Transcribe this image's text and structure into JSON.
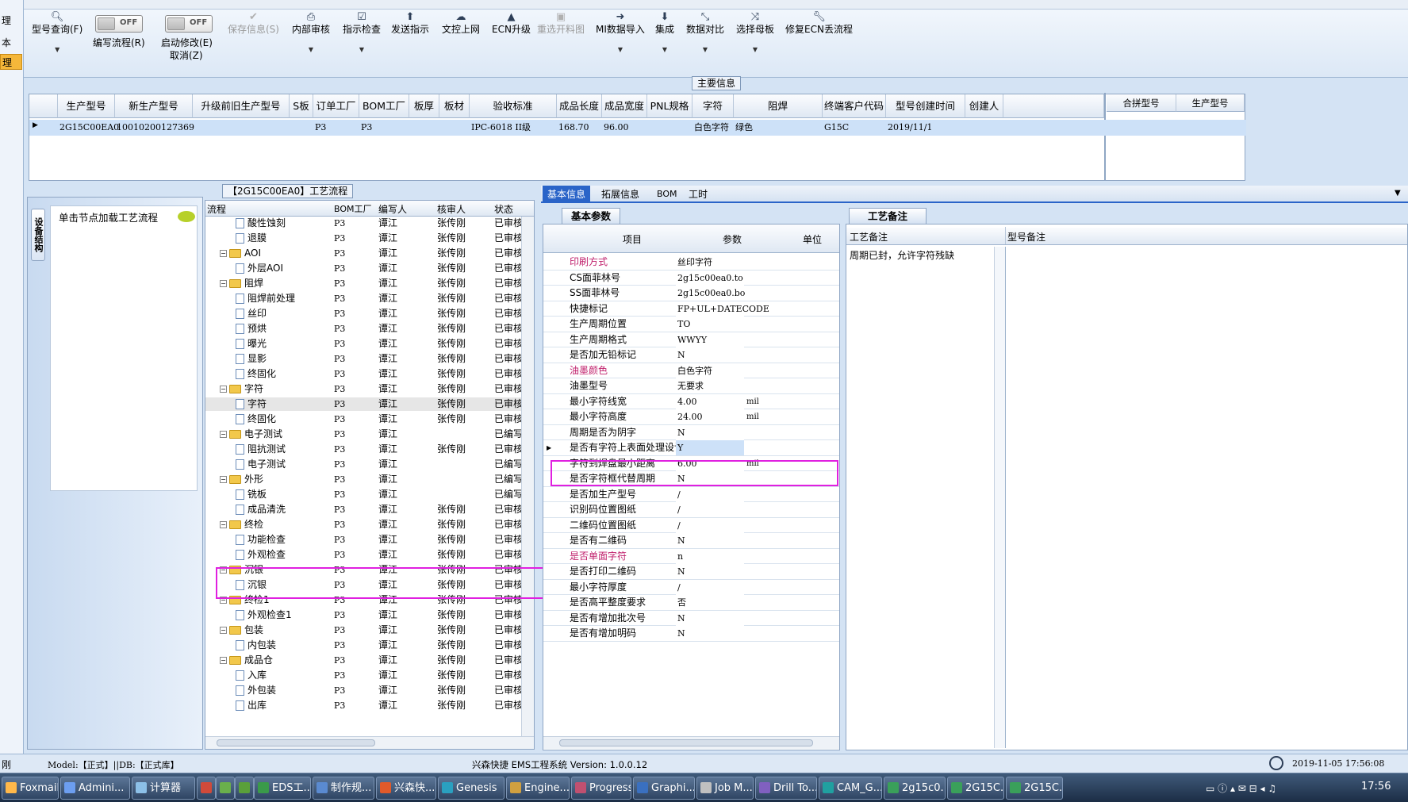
{
  "left_strip": [
    "理",
    "本",
    "理"
  ],
  "toolbar": {
    "query": "型号查询(F)",
    "edit_flow": "编写流程(R)",
    "start_modify": "启动修改(E)",
    "cancel": "取消(Z)",
    "off1": "OFF",
    "off2": "OFF",
    "save_info": "保存信息(S)",
    "internal_review": "内部审核",
    "indicator_check": "指示检查",
    "send_indicator": "发送指示",
    "doc_online": "文控上网",
    "ecn_upgrade": "ECN升级",
    "reselect_drawing": "重选开料图",
    "mi_import": "MI数据导入",
    "integrate": "集成",
    "data_compare": "数据对比",
    "select_master": "选择母板",
    "fix_ecn": "修复ECN丢流程"
  },
  "main_info": {
    "title": "主要信息",
    "columns": [
      "生产型号",
      "新生产型号",
      "升级前旧生产型号",
      "S板",
      "订单工厂",
      "BOM工厂",
      "板厚",
      "板材",
      "验收标准",
      "成品长度",
      "成品宽度",
      "PNL规格",
      "字符",
      "阻焊",
      "终端客户代码",
      "型号创建时间",
      "创建人"
    ],
    "row": [
      "2G15C00EA0",
      "10010200127369",
      "",
      "",
      "P3",
      "P3",
      "",
      "",
      "IPC-6018 II级",
      "168.70",
      "96.00",
      "",
      "白色字符",
      "绿色",
      "G15C",
      "2019/11/1",
      ""
    ],
    "merge_columns": [
      "合拼型号",
      "生产型号"
    ]
  },
  "process": {
    "title": "【2G15C00EA0】工艺流程",
    "side_tab": "设备结构",
    "load_hint": "单击节点加载工艺流程",
    "columns": [
      "流程",
      "BOM工厂",
      "编写人",
      "核审人",
      "状态"
    ],
    "rows": [
      {
        "name": "酸性蚀刻",
        "t": "doc",
        "bom": "P3",
        "w": "谭江",
        "r": "张传刚",
        "s": "已审核"
      },
      {
        "name": "退膜",
        "t": "doc",
        "bom": "P3",
        "w": "谭江",
        "r": "张传刚",
        "s": "已审核"
      },
      {
        "name": "AOI",
        "t": "fold",
        "bom": "P3",
        "w": "谭江",
        "r": "张传刚",
        "s": "已审核"
      },
      {
        "name": "外层AOI",
        "t": "doc",
        "bom": "P3",
        "w": "谭江",
        "r": "张传刚",
        "s": "已审核"
      },
      {
        "name": "阻焊",
        "t": "fold",
        "bom": "P3",
        "w": "谭江",
        "r": "张传刚",
        "s": "已审核"
      },
      {
        "name": "阻焊前处理",
        "t": "doc",
        "bom": "P3",
        "w": "谭江",
        "r": "张传刚",
        "s": "已审核"
      },
      {
        "name": "丝印",
        "t": "doc",
        "bom": "P3",
        "w": "谭江",
        "r": "张传刚",
        "s": "已审核"
      },
      {
        "name": "预烘",
        "t": "doc",
        "bom": "P3",
        "w": "谭江",
        "r": "张传刚",
        "s": "已审核"
      },
      {
        "name": "曝光",
        "t": "doc",
        "bom": "P3",
        "w": "谭江",
        "r": "张传刚",
        "s": "已审核"
      },
      {
        "name": "显影",
        "t": "doc",
        "bom": "P3",
        "w": "谭江",
        "r": "张传刚",
        "s": "已审核"
      },
      {
        "name": "终固化",
        "t": "doc",
        "bom": "P3",
        "w": "谭江",
        "r": "张传刚",
        "s": "已审核"
      },
      {
        "name": "字符",
        "t": "fold",
        "bom": "P3",
        "w": "谭江",
        "r": "张传刚",
        "s": "已审核"
      },
      {
        "name": "字符",
        "t": "doc",
        "bom": "P3",
        "w": "谭江",
        "r": "张传刚",
        "s": "已审核"
      },
      {
        "name": "终固化",
        "t": "doc",
        "bom": "P3",
        "w": "谭江",
        "r": "张传刚",
        "s": "已审核"
      },
      {
        "name": "电子测试",
        "t": "fold",
        "bom": "P3",
        "w": "谭江",
        "r": "",
        "s": "已编写"
      },
      {
        "name": "阻抗测试",
        "t": "doc",
        "bom": "P3",
        "w": "谭江",
        "r": "张传刚",
        "s": "已审核"
      },
      {
        "name": "电子测试",
        "t": "doc",
        "bom": "P3",
        "w": "谭江",
        "r": "",
        "s": "已编写"
      },
      {
        "name": "外形",
        "t": "fold",
        "bom": "P3",
        "w": "谭江",
        "r": "",
        "s": "已编写"
      },
      {
        "name": "铣板",
        "t": "doc",
        "bom": "P3",
        "w": "谭江",
        "r": "",
        "s": "已编写"
      },
      {
        "name": "成品清洗",
        "t": "doc",
        "bom": "P3",
        "w": "谭江",
        "r": "张传刚",
        "s": "已审核"
      },
      {
        "name": "终检",
        "t": "fold",
        "bom": "P3",
        "w": "谭江",
        "r": "张传刚",
        "s": "已审核"
      },
      {
        "name": "功能检查",
        "t": "doc",
        "bom": "P3",
        "w": "谭江",
        "r": "张传刚",
        "s": "已审核"
      },
      {
        "name": "外观检查",
        "t": "doc",
        "bom": "P3",
        "w": "谭江",
        "r": "张传刚",
        "s": "已审核"
      },
      {
        "name": "沉银",
        "t": "fold",
        "bom": "P3",
        "w": "谭江",
        "r": "张传刚",
        "s": "已审核"
      },
      {
        "name": "沉银",
        "t": "doc",
        "bom": "P3",
        "w": "谭江",
        "r": "张传刚",
        "s": "已审核"
      },
      {
        "name": "终检1",
        "t": "fold",
        "bom": "P3",
        "w": "谭江",
        "r": "张传刚",
        "s": "已审核"
      },
      {
        "name": "外观检查1",
        "t": "doc",
        "bom": "P3",
        "w": "谭江",
        "r": "张传刚",
        "s": "已审核"
      },
      {
        "name": "包装",
        "t": "fold",
        "bom": "P3",
        "w": "谭江",
        "r": "张传刚",
        "s": "已审核"
      },
      {
        "name": "内包装",
        "t": "doc",
        "bom": "P3",
        "w": "谭江",
        "r": "张传刚",
        "s": "已审核"
      },
      {
        "name": "成品仓",
        "t": "fold",
        "bom": "P3",
        "w": "谭江",
        "r": "张传刚",
        "s": "已审核"
      },
      {
        "name": "入库",
        "t": "doc",
        "bom": "P3",
        "w": "谭江",
        "r": "张传刚",
        "s": "已审核"
      },
      {
        "name": "外包装",
        "t": "doc",
        "bom": "P3",
        "w": "谭江",
        "r": "张传刚",
        "s": "已审核"
      },
      {
        "name": "出库",
        "t": "doc",
        "bom": "P3",
        "w": "谭江",
        "r": "张传刚",
        "s": "已审核"
      }
    ]
  },
  "detail_tabs": [
    "基本信息",
    "拓展信息",
    "BOM",
    "工时"
  ],
  "basic_params": {
    "title": "基本参数",
    "columns": [
      "项目",
      "参数",
      "单位"
    ],
    "rows": [
      {
        "k": "印刷方式",
        "v": "丝印字符",
        "u": "",
        "pink": true
      },
      {
        "k": "CS面菲林号",
        "v": "2g15c00ea0.to",
        "u": ""
      },
      {
        "k": "SS面菲林号",
        "v": "2g15c00ea0.bo",
        "u": ""
      },
      {
        "k": "快捷标记",
        "v": "FP+UL+DATECODE",
        "u": ""
      },
      {
        "k": "生产周期位置",
        "v": "TO",
        "u": ""
      },
      {
        "k": "生产周期格式",
        "v": "WWYY",
        "u": ""
      },
      {
        "k": "是否加无铅标记",
        "v": "N",
        "u": ""
      },
      {
        "k": "油墨颜色",
        "v": "白色字符",
        "u": "",
        "pink": true
      },
      {
        "k": "油墨型号",
        "v": "无要求",
        "u": ""
      },
      {
        "k": "最小字符线宽",
        "v": "4.00",
        "u": "mil"
      },
      {
        "k": "最小字符高度",
        "v": "24.00",
        "u": "mil"
      },
      {
        "k": "周期是否为阴字",
        "v": "N",
        "u": ""
      },
      {
        "k": "是否有字符上表面处理设计",
        "v": "Y",
        "u": "",
        "selected": true
      },
      {
        "k": "字符到焊盘最小距离",
        "v": "6.00",
        "u": "mil"
      },
      {
        "k": "是否字符框代替周期",
        "v": "N",
        "u": ""
      },
      {
        "k": "是否加生产型号",
        "v": "/",
        "u": ""
      },
      {
        "k": "识别码位置图纸",
        "v": "/",
        "u": ""
      },
      {
        "k": "二维码位置图纸",
        "v": "/",
        "u": ""
      },
      {
        "k": "是否有二维码",
        "v": "N",
        "u": ""
      },
      {
        "k": "是否单面字符",
        "v": "n",
        "u": "",
        "pink": true
      },
      {
        "k": "是否打印二维码",
        "v": "N",
        "u": ""
      },
      {
        "k": "最小字符厚度",
        "v": "/",
        "u": ""
      },
      {
        "k": "是否高平整度要求",
        "v": "否",
        "u": ""
      },
      {
        "k": "是否有增加批次号",
        "v": "N",
        "u": ""
      },
      {
        "k": "是否有增加明码",
        "v": "N",
        "u": ""
      }
    ]
  },
  "remarks": {
    "title": "工艺备注",
    "col1": "工艺备注",
    "col2": "型号备注",
    "text": "周期已封，允许字符残缺"
  },
  "status": {
    "left": "刚",
    "model": "Model:【正式】||DB:【正式库】",
    "center": "兴森快捷 EMS工程系统 Version: 1.0.0.12",
    "datetime": "2019-11-05 17:56:08"
  },
  "taskbar": {
    "items": [
      "Foxmail",
      "Admini...",
      "计算器",
      "",
      "",
      "",
      "EDS工...",
      "制作规...",
      "兴森快...",
      "Genesis",
      "Engine...",
      "Progress",
      "Graphi...",
      "Job M...",
      "Drill To...",
      "CAM_G...",
      "2g15c0...",
      "2G15C...",
      "2G15C..."
    ],
    "clock": "17:56"
  },
  "colors": {
    "pink": "#c0206c",
    "highlight": "#e020e0",
    "selection": "#cde1f8",
    "tab_active": "#2a64c8"
  }
}
